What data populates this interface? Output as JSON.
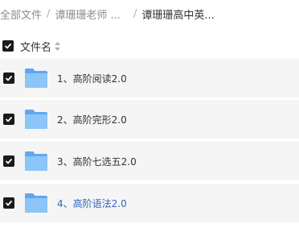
{
  "breadcrumb": {
    "items": [
      "全部文件",
      "谭珊珊老师 ...",
      "谭珊珊高中英..."
    ],
    "separator": "/"
  },
  "header": {
    "column_label": "文件名",
    "select_all_checked": true
  },
  "files": [
    {
      "name": "1、高阶阅读2.0",
      "checked": true
    },
    {
      "name": "2、高阶完形2.0",
      "checked": true
    },
    {
      "name": "3、高阶七选五2.0",
      "checked": true
    },
    {
      "name": "4、高阶语法2.0",
      "checked": true
    }
  ],
  "colors": {
    "row_background": "#f5f5f5",
    "checkbox": "#1a1a1a",
    "folder": "#7ab8f5",
    "link_active": "#2b64c5"
  }
}
